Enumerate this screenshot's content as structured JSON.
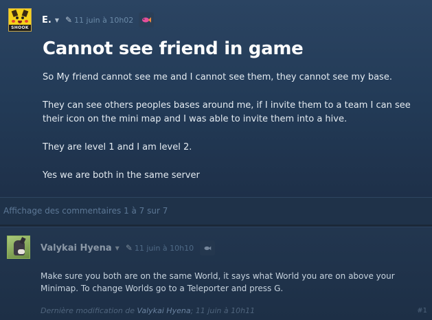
{
  "topic": {
    "author": "E.",
    "date": "11 juin à 10h02",
    "avatar_text": "SHOOK",
    "title": "Cannot see friend in game",
    "paragraphs": [
      "So My friend cannot see me and I cannot see them, they cannot see my base.",
      "They can see others peoples bases around me, if I invite them to a team I can see their icon on the mini map and I was able to invite them into a hive.",
      "They are level 1 and I am level 2.",
      "Yes we are both in the same server"
    ]
  },
  "comments_header": {
    "text": "Affichage des commentaires 1 à 7 sur 7"
  },
  "comment": {
    "author": "Valykai Hyena",
    "date": "11 juin à 10h10",
    "text": "Make sure you both are on the same World, it says what World you are on above your Minimap. To change Worlds go to a Teleporter and press G.",
    "footer_prefix": "Dernière modification de",
    "footer_author": "Valykai Hyena",
    "footer_date": "; 11 juin à 10h11",
    "number": "#1"
  },
  "icons": {
    "caret": "caret-down-icon",
    "feather": "feather-icon",
    "badge": "fish-badge-icon"
  },
  "colors": {
    "background": "#1b2838",
    "title": "#ffffff",
    "date": "#6c8ba8",
    "badge_accent": "#e54f9c"
  }
}
